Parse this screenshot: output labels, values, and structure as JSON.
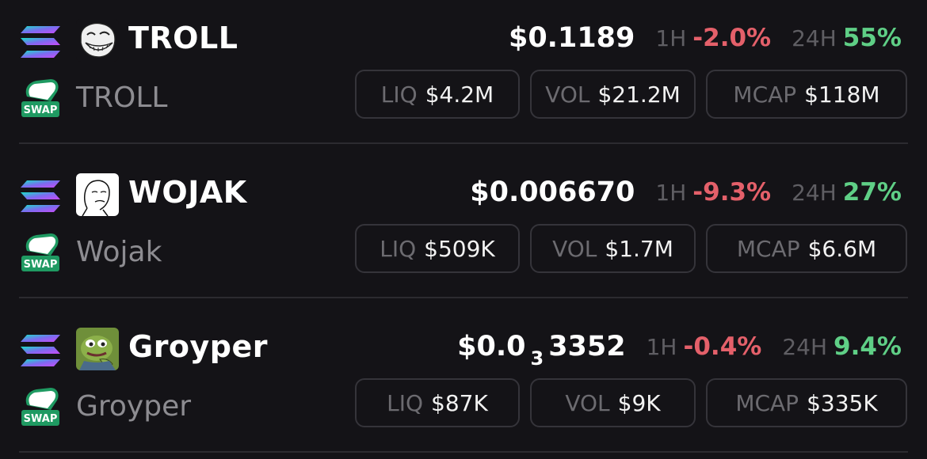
{
  "tokens": [
    {
      "symbol": "TROLL",
      "name": "TROLL",
      "chain_icon": "solana-icon",
      "avatar_icon": "trollface-icon",
      "price": {
        "main": "$0.1189",
        "zeros": "",
        "rest": ""
      },
      "h1_label": "1H",
      "h1_change": "-2.0%",
      "h24_label": "24H",
      "h24_change": "55%",
      "liq_label": "LIQ",
      "liq": "$4.2M",
      "vol_label": "VOL",
      "vol": "$21.2M",
      "mcap_label": "MCAP",
      "mcap": "$118M"
    },
    {
      "symbol": "WOJAK",
      "name": "Wojak",
      "chain_icon": "solana-icon",
      "avatar_icon": "wojak-icon",
      "price": {
        "main": "$0.006670",
        "zeros": "",
        "rest": ""
      },
      "h1_label": "1H",
      "h1_change": "-9.3%",
      "h24_label": "24H",
      "h24_change": "27%",
      "liq_label": "LIQ",
      "liq": "$509K",
      "vol_label": "VOL",
      "vol": "$1.7M",
      "mcap_label": "MCAP",
      "mcap": "$6.6M"
    },
    {
      "symbol": "Groyper",
      "name": "Groyper",
      "chain_icon": "solana-icon",
      "avatar_icon": "groyper-frog-icon",
      "price": {
        "main": "$0.0",
        "zeros": "3",
        "rest": "3352"
      },
      "h1_label": "1H",
      "h1_change": "-0.4%",
      "h24_label": "24H",
      "h24_change": "9.4%",
      "liq_label": "LIQ",
      "liq": "$87K",
      "vol_label": "VOL",
      "vol": "$9K",
      "mcap_label": "MCAP",
      "mcap": "$335K"
    }
  ],
  "swap_badge_text": "SWAP",
  "colors": {
    "background": "#141317",
    "negative": "#e4606a",
    "positive": "#5fcf86",
    "muted": "#8d8c91",
    "swap_green": "#1f9a62"
  }
}
